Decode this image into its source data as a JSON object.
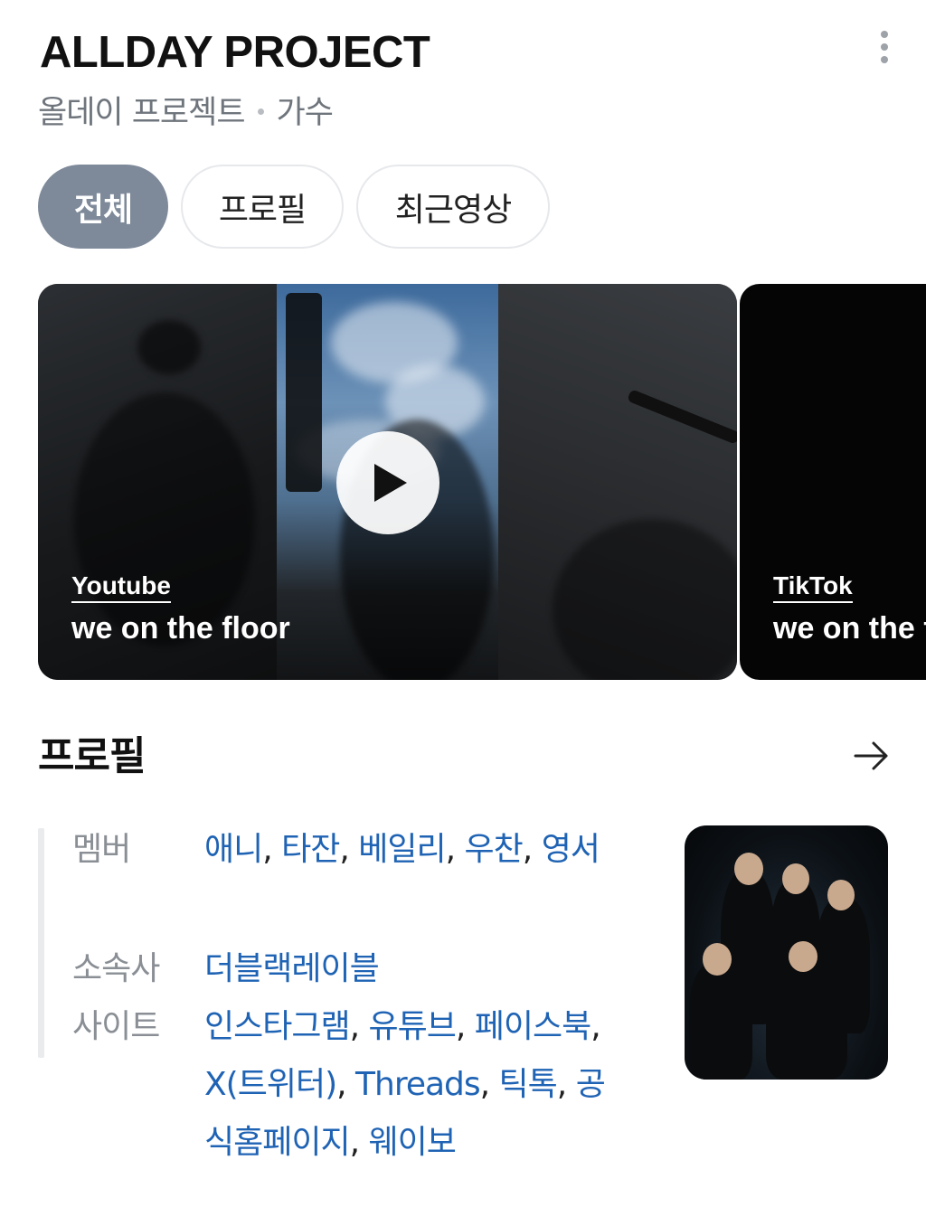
{
  "header": {
    "title": "ALLDAY PROJECT",
    "subtitle_name": "올데이 프로젝트",
    "subtitle_category": "가수",
    "more_icon": "more-vertical-icon"
  },
  "tabs": [
    {
      "label": "전체",
      "active": true
    },
    {
      "label": "프로필",
      "active": false
    },
    {
      "label": "최근영상",
      "active": false
    }
  ],
  "videos": [
    {
      "source": "Youtube",
      "title": "we on the floor"
    },
    {
      "source": "TikTok",
      "title": "we on the floor"
    }
  ],
  "profile": {
    "section_title": "프로필",
    "arrow_icon": "arrow-right-icon",
    "rows": [
      {
        "label": "멤버",
        "values": [
          "애니",
          "타잔",
          "베일리",
          "우찬",
          "영서"
        ]
      },
      {
        "label": "소속사",
        "values": [
          "더블랙레이블"
        ]
      },
      {
        "label": "사이트",
        "values": [
          "인스타그램",
          "유튜브",
          "페이스북",
          "X(트위터)",
          "Threads",
          "틱톡",
          "공식홈페이지",
          "웨이보"
        ]
      }
    ]
  },
  "colors": {
    "tab_active_bg": "#7e8a9a",
    "link": "#1f63b4",
    "label_gray": "#8a8f95"
  }
}
